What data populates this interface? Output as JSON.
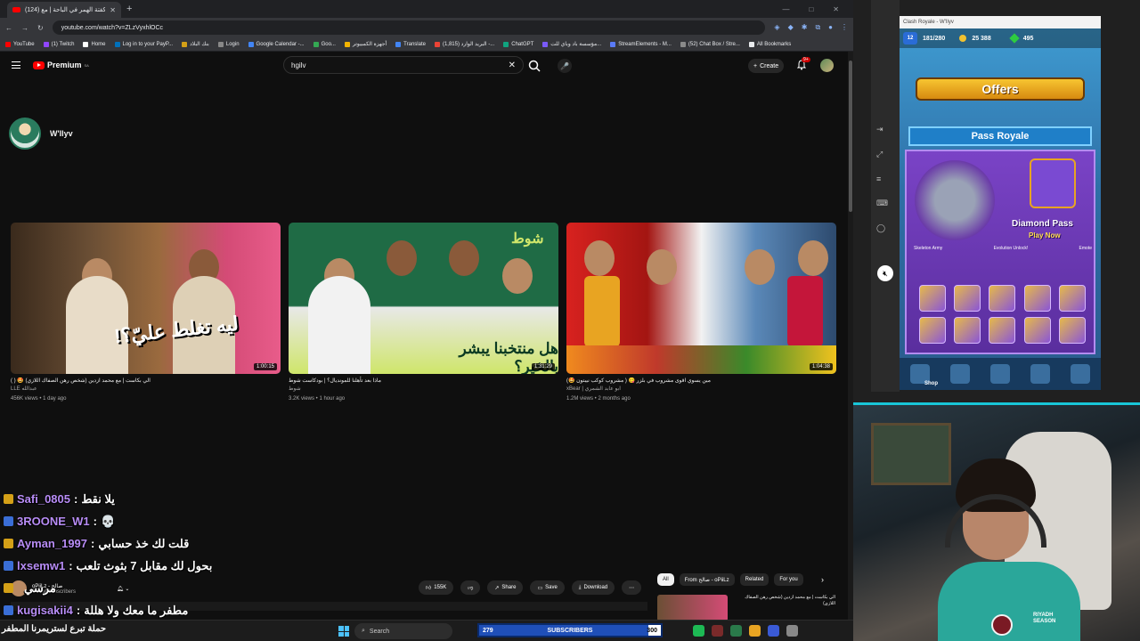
{
  "browser": {
    "tab_title": "(124) كفتة الهمر في الباحة | مع",
    "url": "youtube.com/watch?v=ZLzVyxhlOCc",
    "bookmarks": [
      "YouTube",
      "(1) Twitch",
      "Home",
      "Log in to your PayP...",
      "بنك البلاد",
      "Login",
      "Google Calendar -...",
      "Goo...",
      "أجهزة الكمبيوتر",
      "Translate",
      "(1,815) البريد الوارد -...",
      "ChatGPT",
      "مؤسسة باد وباي للت...",
      "StreamElements - M...",
      "(52) Chat Box / Stre...",
      "All Bookmarks"
    ]
  },
  "youtube": {
    "logo": "Premium",
    "logo_region": "SA",
    "search_value": "hgilv",
    "create_label": "Create",
    "notif_count": "9+",
    "channel_name": "W'Ilyv",
    "videos": [
      {
        "title": "الي بكاست | مع محمد ازدين (شخص رهن الصفاك اللازي) 🤩 ( )",
        "channel": "LLE عبدالله",
        "stats": "456K views • 1 day ago",
        "duration": "1:00:15",
        "thumb_text": "ليه تغلط عليّ؟!"
      },
      {
        "title": "ماذا بعد تأهلنا للمونديال؟ | بودكاست شوط",
        "channel": "شوط",
        "stats": "3.2K views • 1 hour ago",
        "duration": "1:31:29",
        "thumb_text": "هل منتخبنا يبشر بالخير؟",
        "thumb_logo": "شوط"
      },
      {
        "title": "مين يسوي اقوى مشروب في بلزر 😋 ( مشروب كوكب نيبتون 🤩)",
        "channel": "xBear | ابو عابد الشمري",
        "stats": "1.2M views • 2 months ago",
        "duration": "1:04:38",
        "thumb_text": ""
      }
    ],
    "actions": {
      "likes": "155K",
      "share": "Share",
      "save": "Save",
      "download": "Download"
    },
    "chips": [
      "All",
      "From صالح - oPiiLz",
      "Related",
      "For you"
    ],
    "watch_channel": "oPiiLz - صالح",
    "watch_subs": "9.86M subscribers",
    "side_video": "الي بكاست | مع محمد ازدين (شخص رهن الصفاك اللازي)"
  },
  "chat": [
    {
      "user": "Safi_0805",
      "text": "يلا نقط",
      "color": "#b78cf5"
    },
    {
      "user": "3ROONE_W1",
      "text": "💀",
      "color": "#b78cf5"
    },
    {
      "user": "Ayman_1997",
      "text": "قلت لك خذ حسابي",
      "color": "#b78cf5"
    },
    {
      "user": "lxsemw1",
      "text": "بحول لك مقابل 7 بثوث تلعب",
      "color": "#b78cf5"
    },
    {
      "user": "",
      "text": "مرسي",
      "color": "#b78cf5"
    },
    {
      "user": "kugisakii4",
      "text": "مطفر ما معك ولا هللة",
      "color": "#b78cf5"
    }
  ],
  "taskbar": {
    "banner": "حملة تبرع لستريمرنا المطفر",
    "search": "Search",
    "subs_current": "279",
    "subs_label": "SUBSCRIBERS",
    "subs_goal": "300",
    "subs_progress": 0.93
  },
  "game": {
    "window_title": "Clash Royale - W'Ilyv",
    "level": "12",
    "trophy": "181/280",
    "gold": "25 388",
    "gems": "495",
    "offers": "Offers",
    "pass_title": "Pass Royale",
    "diamond_pass": "Diamond Pass",
    "play_now": "Play Now",
    "reward_labels": [
      "Skeleton Army",
      "Evolution Unlock!",
      "Emote"
    ],
    "shop": "Shop"
  },
  "cam": {
    "sponsor": "RIYADH SEASON"
  }
}
